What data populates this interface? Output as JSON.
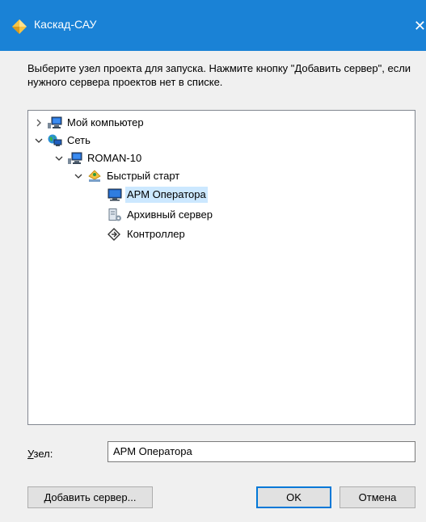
{
  "window": {
    "title": "Каскад-САУ",
    "close_glyph": "✕",
    "app_icon": "kaskad-diamond-icon"
  },
  "instruction": "Выберите узел проекта для запуска. Нажмите кнопку \"Добавить сервер\", если нужного сервера проектов нет в списке.",
  "tree": {
    "nodes": [
      {
        "label": "Мой компьютер",
        "icon": "computer-icon",
        "expander": "collapsed"
      },
      {
        "label": "Сеть",
        "icon": "network-icon",
        "expander": "expanded"
      },
      {
        "label": "ROMAN-10",
        "icon": "computer-icon",
        "expander": "expanded"
      },
      {
        "label": "Быстрый старт",
        "icon": "project-icon",
        "expander": "expanded"
      },
      {
        "label": "АРМ Оператора",
        "icon": "monitor-icon",
        "expander": "none",
        "selected": true
      },
      {
        "label": "Архивный сервер",
        "icon": "archive-server-icon",
        "expander": "none"
      },
      {
        "label": "Контроллер",
        "icon": "controller-icon",
        "expander": "none"
      }
    ]
  },
  "node_field": {
    "label_prefix": "У",
    "label_rest": "зел:",
    "value": "АРМ Оператора"
  },
  "buttons": {
    "add_server_prefix": "Д",
    "add_server_rest": "обавить сервер...",
    "ok": "OK",
    "cancel": "Отмена"
  },
  "colors": {
    "titlebar": "#1a82d6",
    "selection": "#cce8ff",
    "default_button_border": "#0078d7"
  }
}
